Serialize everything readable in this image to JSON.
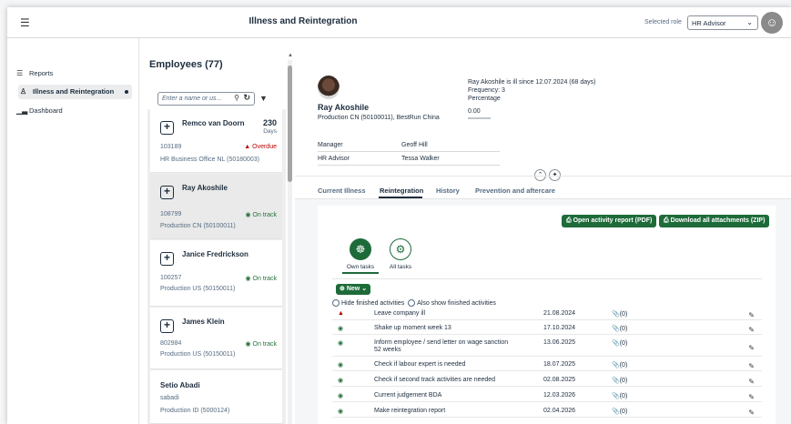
{
  "shell": {
    "menu_icon": "menu-icon",
    "title": "Illness and Reintegration",
    "role_label": "Selected role",
    "role_value": "HR Advisor",
    "avatar_icon": "user-icon"
  },
  "nav": {
    "items": [
      {
        "label": "Reports",
        "icon": "list-icon"
      },
      {
        "label": "Illness and Reintegration",
        "icon": "person-icon"
      },
      {
        "label": "Dashboard",
        "icon": "bar-chart-icon"
      }
    ]
  },
  "employees": {
    "title": "Employees (77)",
    "search_placeholder": "Enter a name or us...",
    "list": [
      {
        "name": "Remco van Doorn",
        "days": "230",
        "days_label": "Days",
        "id": "103189",
        "status": "Overdue",
        "org": "HR Business Office NL (50180003)"
      },
      {
        "name": "Ray Akoshile",
        "id": "108799",
        "status": "On track",
        "org": "Production CN (50100011)"
      },
      {
        "name": "Janice Fredrickson",
        "id": "100257",
        "status": "On track",
        "org": "Production US (50150011)"
      },
      {
        "name": "James Klein",
        "id": "802984",
        "status": "On track",
        "org": "Production US (50150011)"
      },
      {
        "name": "Setio Abadi",
        "sub": "sabadi",
        "org": "Production ID (5000124)"
      }
    ]
  },
  "detail": {
    "name": "Ray Akoshile",
    "org": "Production CN (50100011), BestRun China",
    "ill_since": "Ray Akoshile is ill since 12.07.2024 (68 days)",
    "frequency": "Frequency: 3",
    "percentage_label": "Percentage",
    "percentage_value": "0.00",
    "manager_label": "Manager",
    "manager_value": "Geoff Hill",
    "hr_label": "HR Advisor",
    "hr_value": "Tessa Walker",
    "tabs": [
      "Current Illness",
      "Reintegration",
      "History",
      "Prevention and aftercare"
    ],
    "buttons": {
      "activity_report": "Open activity report (PDF)",
      "download_all": "Download all attachments (ZIP)",
      "new": "New"
    },
    "task_tabs": [
      "Own tasks",
      "All tasks"
    ],
    "radio": {
      "hide": "Hide finished activities",
      "show": "Also show finished activities"
    },
    "activities": [
      {
        "title": "Leave company ill",
        "date": "21.08.2024",
        "att": "(0)",
        "status": "warn"
      },
      {
        "title": "Shake up moment week 13",
        "date": "17.10.2024",
        "att": "(0)",
        "status": "ok"
      },
      {
        "title": "Inform employee / send letter on wage sanction 52 weeks",
        "date": "13.06.2025",
        "att": "(0)",
        "status": "ok"
      },
      {
        "title": "Check if labour expert is needed",
        "date": "18.07.2025",
        "att": "(0)",
        "status": "ok"
      },
      {
        "title": "Check if second track activities are needed",
        "date": "02.08.2025",
        "att": "(0)",
        "status": "ok"
      },
      {
        "title": "Current judgement BDA",
        "date": "12.03.2026",
        "att": "(0)",
        "status": "ok"
      },
      {
        "title": "Make reintegration report",
        "date": "02.04.2026",
        "att": "(0)",
        "status": "ok"
      }
    ]
  }
}
